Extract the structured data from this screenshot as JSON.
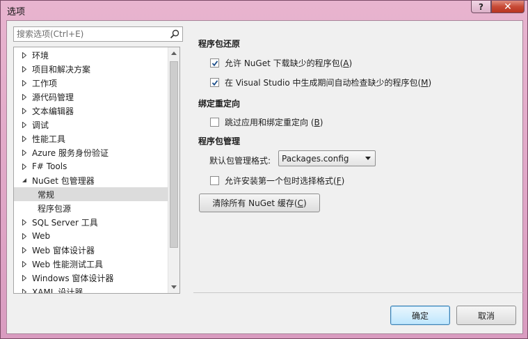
{
  "window": {
    "title": "选项",
    "help_label": "?",
    "close_label": "✕"
  },
  "search": {
    "placeholder": "搜索选项(Ctrl+E)"
  },
  "tree": {
    "items": [
      {
        "label": "环境",
        "expander": "collapsed"
      },
      {
        "label": "项目和解决方案",
        "expander": "collapsed"
      },
      {
        "label": "工作项",
        "expander": "collapsed"
      },
      {
        "label": "源代码管理",
        "expander": "collapsed"
      },
      {
        "label": "文本编辑器",
        "expander": "collapsed"
      },
      {
        "label": "调试",
        "expander": "collapsed"
      },
      {
        "label": "性能工具",
        "expander": "collapsed"
      },
      {
        "label": "Azure 服务身份验证",
        "expander": "collapsed"
      },
      {
        "label": "F# Tools",
        "expander": "collapsed"
      },
      {
        "label": "NuGet 包管理器",
        "expander": "expanded"
      },
      {
        "label": "常规",
        "expander": "none",
        "child": true,
        "selected": true
      },
      {
        "label": "程序包源",
        "expander": "none",
        "child": true
      },
      {
        "label": "SQL Server 工具",
        "expander": "collapsed"
      },
      {
        "label": "Web",
        "expander": "collapsed"
      },
      {
        "label": "Web 窗体设计器",
        "expander": "collapsed"
      },
      {
        "label": "Web 性能测试工具",
        "expander": "collapsed"
      },
      {
        "label": "Windows 窗体设计器",
        "expander": "collapsed"
      },
      {
        "label": "XAML 设计器",
        "expander": "collapsed"
      }
    ]
  },
  "package_restore": {
    "heading": "程序包还原",
    "allow_download": {
      "label": "允许 NuGet 下载缺少的程序包(",
      "mnemonic": "A",
      "suffix": ")",
      "checked": true
    },
    "auto_check": {
      "label": "在 Visual Studio 中生成期间自动检查缺少的程序包(",
      "mnemonic": "M",
      "suffix": ")",
      "checked": true
    }
  },
  "binding_redirects": {
    "heading": "绑定重定向",
    "skip": {
      "label": "跳过应用和绑定重定向 (",
      "mnemonic": "B",
      "suffix": ")",
      "checked": false
    }
  },
  "package_management": {
    "heading": "程序包管理",
    "format_label": "默认包管理格式:",
    "format_value": "Packages.config",
    "allow_choose": {
      "label": "允许安装第一个包时选择格式(",
      "mnemonic": "F",
      "suffix": ")",
      "checked": false
    },
    "clear_cache": {
      "label": "清除所有 NuGet 缓存(",
      "mnemonic": "C",
      "suffix": ")"
    }
  },
  "footer": {
    "ok_label": "确定",
    "cancel_label": "取消"
  },
  "colors": {
    "accent": "#3c7fb1",
    "check": "#1e4f8a"
  }
}
